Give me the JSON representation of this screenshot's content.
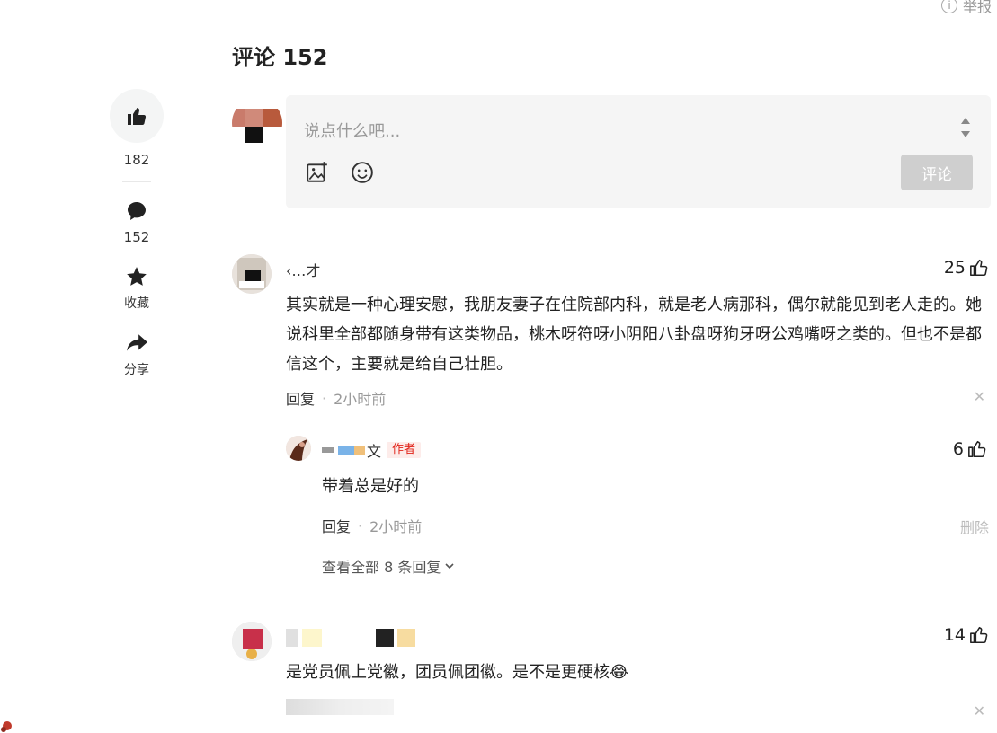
{
  "header": {
    "report_label": "举报"
  },
  "rail": {
    "like_count": "182",
    "comment_count": "152",
    "favorite_label": "收藏",
    "share_label": "分享"
  },
  "comments_section": {
    "title": "评论 152",
    "input_placeholder": "说点什么吧...",
    "submit_label": "评论"
  },
  "comments": [
    {
      "username": "‹…才",
      "likes": "25",
      "text": "其实就是一种心理安慰，我朋友妻子在住院部内科，就是老人病那科，偶尔就能见到老人走的。她说科里全部都随身带有这类物品，桃木呀符呀小阴阳八卦盘呀狗牙呀公鸡嘴呀之类的。但也不是都信这个，主要就是给自己壮胆。",
      "reply_label": "回复",
      "time": "2小时前",
      "replies": [
        {
          "username_suffix": "文",
          "author_tag": "作者",
          "likes": "6",
          "text": "带着总是好的",
          "reply_label": "回复",
          "time": "2小时前",
          "delete_label": "删除"
        }
      ],
      "view_all_label": "查看全部 8 条回复"
    },
    {
      "likes": "14",
      "text": "是党员佩上党徽，团员佩团徽。是不是更硬核😂"
    }
  ],
  "colors": {
    "author_tag": "#e1251b",
    "submit_disabled": "#cfcfcf",
    "input_bg": "#f5f5f5"
  }
}
